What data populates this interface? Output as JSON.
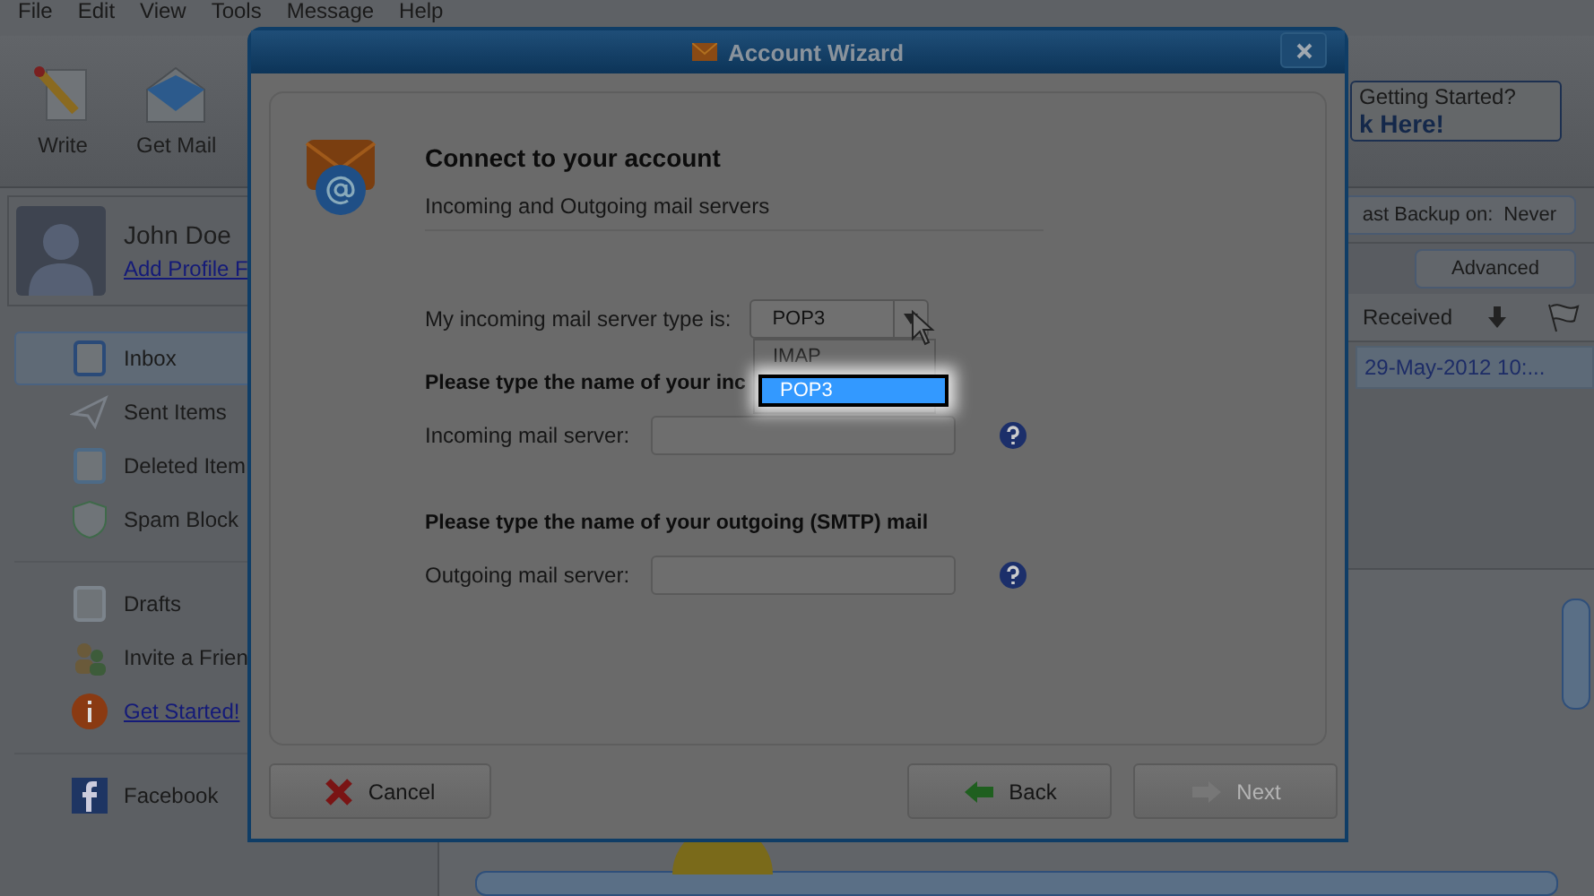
{
  "menu": [
    "File",
    "Edit",
    "View",
    "Tools",
    "Message",
    "Help"
  ],
  "toolbar": [
    {
      "label": "Write",
      "kind": "write"
    },
    {
      "label": "Get Mail",
      "kind": "getmail"
    }
  ],
  "promo": {
    "line1": "Getting Started?",
    "line2": "k Here!"
  },
  "profile": {
    "name": "John Doe",
    "link": "Add Profile F"
  },
  "folder_groups": [
    [
      {
        "label": "Inbox",
        "kind": "inbox",
        "selected": true,
        "link": false
      },
      {
        "label": "Sent Items",
        "kind": "sent",
        "selected": false,
        "link": false
      },
      {
        "label": "Deleted Item",
        "kind": "trash",
        "selected": false,
        "link": false
      },
      {
        "label": "Spam Block",
        "kind": "shield",
        "selected": false,
        "link": false
      }
    ],
    [
      {
        "label": "Drafts",
        "kind": "drafts",
        "selected": false,
        "link": false
      },
      {
        "label": "Invite a Frien",
        "kind": "people",
        "selected": false,
        "link": false
      },
      {
        "label": "Get Started!",
        "kind": "info",
        "selected": false,
        "link": true
      }
    ],
    [
      {
        "label": "Facebook",
        "kind": "facebook",
        "selected": false,
        "link": false
      }
    ]
  ],
  "backup": {
    "label": "ast Backup on:",
    "value": "Never"
  },
  "advanced": "Advanced",
  "columns": [
    {
      "label": "Received"
    }
  ],
  "rows": [
    {
      "received": "29-May-2012 10:..."
    }
  ],
  "dialog": {
    "title": "Account Wizard",
    "heading": "Connect to your account",
    "subtitle": "Incoming and Outgoing mail servers",
    "server_type": {
      "label": "My incoming mail server type is:",
      "value": "POP3",
      "expanded": true,
      "options": [
        {
          "label": "IMAP",
          "selected": false
        },
        {
          "label": "POP3",
          "selected": true
        }
      ]
    },
    "incoming": {
      "heading": "Please type the name of your inc",
      "label": "Incoming mail server:"
    },
    "outgoing": {
      "heading": "Please type the name of your outgoing (SMTP) mail",
      "label": "Outgoing mail server:"
    },
    "buttons": [
      {
        "label": "Cancel",
        "kind": "cancel",
        "disabled": false
      },
      {
        "label": "Back",
        "kind": "back",
        "disabled": false
      },
      {
        "label": "Next",
        "kind": "next",
        "disabled": true
      }
    ]
  }
}
